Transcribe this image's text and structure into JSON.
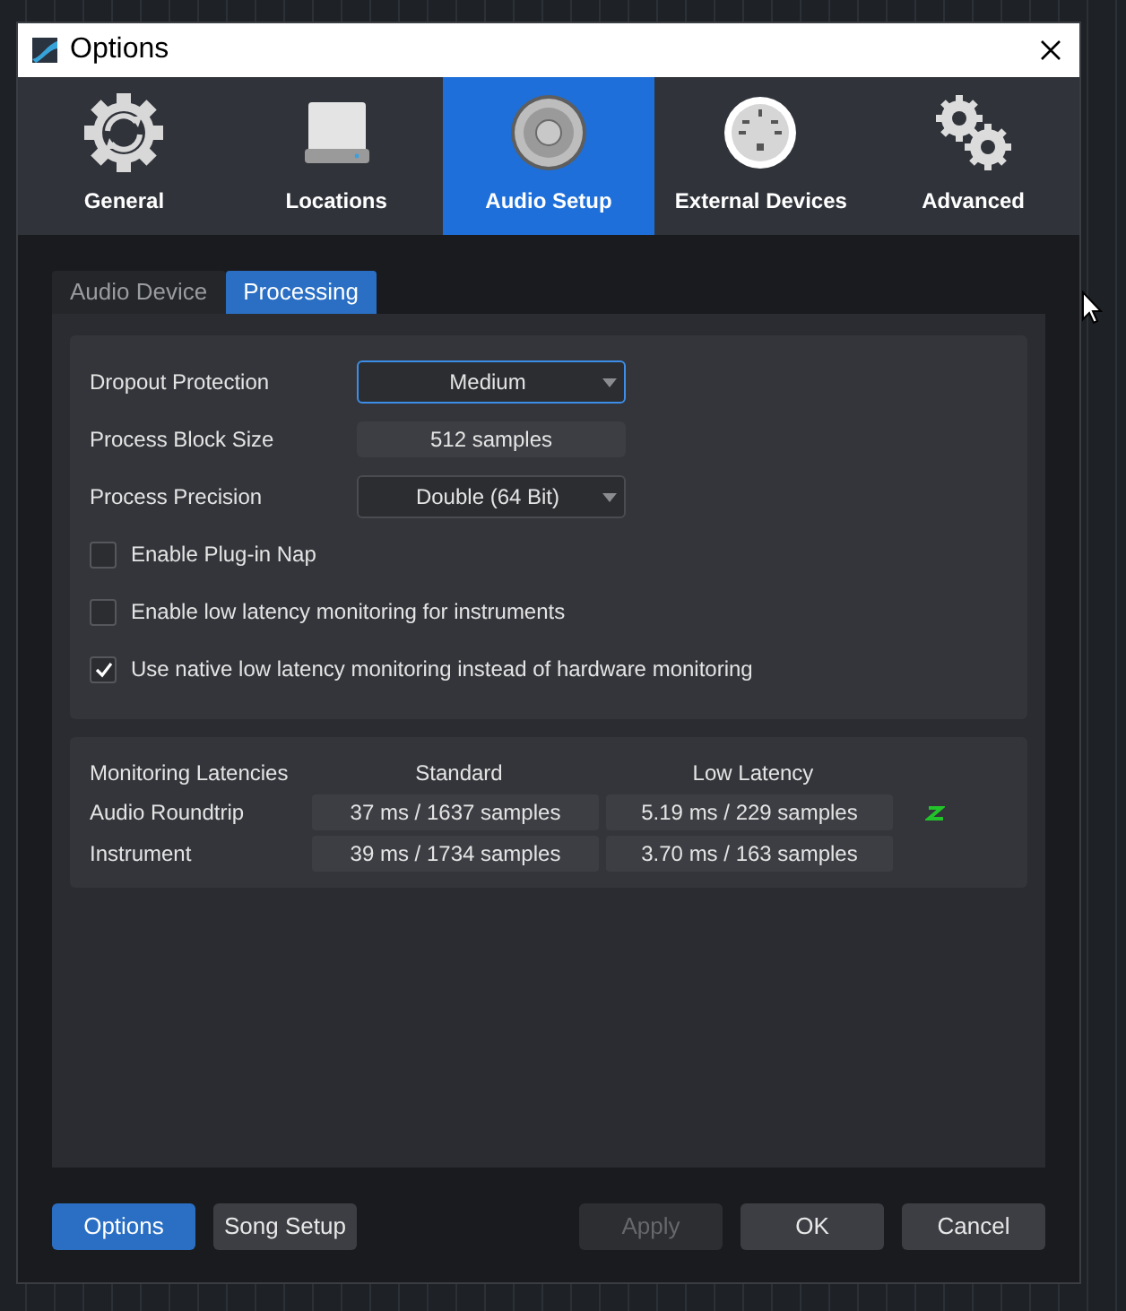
{
  "window": {
    "title": "Options"
  },
  "categories": [
    {
      "label": "General",
      "selected": false
    },
    {
      "label": "Locations",
      "selected": false
    },
    {
      "label": "Audio Setup",
      "selected": true
    },
    {
      "label": "External Devices",
      "selected": false
    },
    {
      "label": "Advanced",
      "selected": false
    }
  ],
  "tabs": [
    {
      "label": "Audio Device",
      "selected": false
    },
    {
      "label": "Processing",
      "selected": true
    }
  ],
  "settings": [
    {
      "kind": "dropdown",
      "label": "Dropout Protection",
      "value": "Medium",
      "focused": true
    },
    {
      "kind": "readout",
      "label": "Process Block Size",
      "value": "512 samples"
    },
    {
      "kind": "dropdown",
      "label": "Process Precision",
      "value": "Double (64 Bit)",
      "focused": false
    },
    {
      "kind": "checkbox",
      "label": "Enable Plug-in Nap",
      "checked": false
    },
    {
      "kind": "checkbox",
      "label": "Enable low latency monitoring for instruments",
      "checked": false
    },
    {
      "kind": "checkbox",
      "label": "Use native low latency monitoring instead of hardware monitoring",
      "checked": true
    }
  ],
  "latency": {
    "columns": [
      "Monitoring Latencies",
      "Standard",
      "Low Latency"
    ],
    "rows": [
      {
        "label": "Audio Roundtrip",
        "standard": "37 ms / 1637 samples",
        "low": "5.19 ms / 229 samples",
        "active": true
      },
      {
        "label": "Instrument",
        "standard": "39 ms / 1734 samples",
        "low": "3.70 ms / 163 samples",
        "active": false
      }
    ]
  },
  "buttons_left": [
    {
      "label": "Options",
      "kind": "primary",
      "disabled": false
    },
    {
      "label": "Song Setup",
      "kind": "normal",
      "disabled": false
    }
  ],
  "buttons_right": [
    {
      "label": "Apply",
      "kind": "normal",
      "disabled": true
    },
    {
      "label": "OK",
      "kind": "normal",
      "disabled": false
    },
    {
      "label": "Cancel",
      "kind": "normal",
      "disabled": false
    }
  ]
}
